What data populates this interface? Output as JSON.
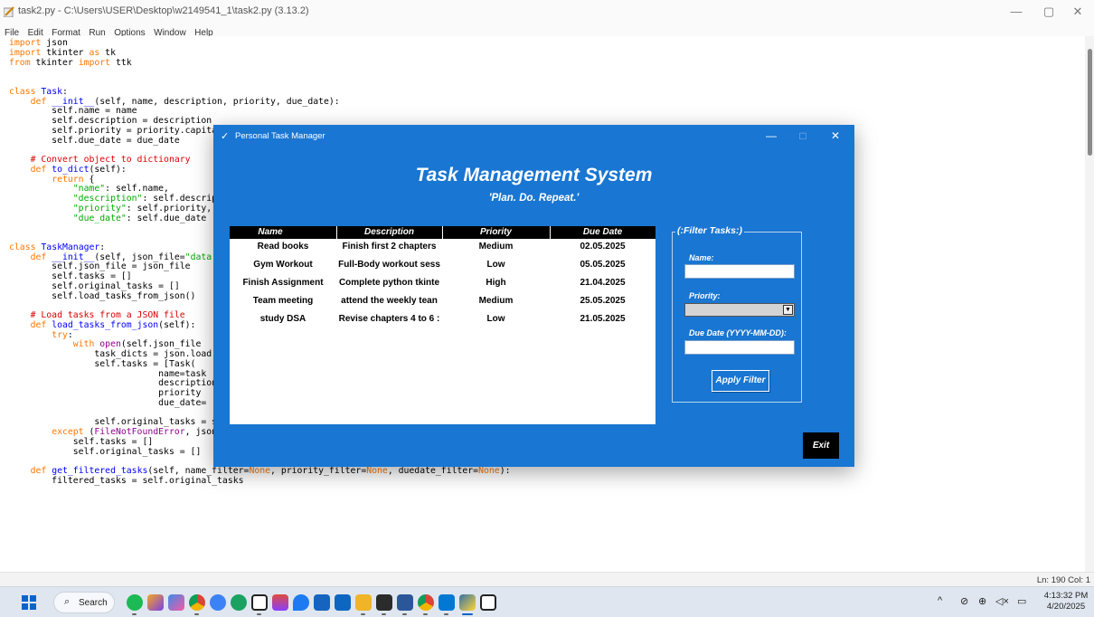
{
  "idle": {
    "window_title": "task2.py - C:\\Users\\USER\\Desktop\\w2149541_1\\task2.py (3.13.2)",
    "menus": [
      "File",
      "Edit",
      "Format",
      "Run",
      "Options",
      "Window",
      "Help"
    ],
    "status_position": "Ln: 190   Col: 1",
    "window_controls": {
      "minimize": "—",
      "restore": "▢",
      "close": "✕"
    }
  },
  "tk_app": {
    "window_title": "Personal Task Manager",
    "heading": "Task Management System",
    "tagline": "'Plan. Do. Repeat.'",
    "controls": {
      "minimize": "—",
      "maximize": "□",
      "close": "✕"
    },
    "table": {
      "columns": [
        "Name",
        "Description",
        "Priority",
        "Due Date"
      ],
      "rows": [
        {
          "name": "Read books",
          "description": "Finish first 2 chapters",
          "priority": "Medium",
          "due": "02.05.2025"
        },
        {
          "name": "Gym Workout",
          "description": "Full-Body workout sess",
          "priority": "Low",
          "due": "05.05.2025"
        },
        {
          "name": "Finish Assignment",
          "description": "Complete python tkintе",
          "priority": "High",
          "due": "21.04.2025"
        },
        {
          "name": "Team meeting",
          "description": "attend the weekly tean",
          "priority": "Medium",
          "due": "25.05.2025"
        },
        {
          "name": "study DSA",
          "description": "Revise chapters 4 to 6 :",
          "priority": "Low",
          "due": "21.05.2025"
        }
      ]
    },
    "filter": {
      "legend": "(:Filter Tasks:)",
      "name_label": "Name:",
      "name_value": "",
      "priority_label": "Priority:",
      "priority_value": "",
      "due_label": "Due Date (YYYY-MM-DD):",
      "due_value": "",
      "apply_label": "Apply Filter"
    },
    "exit_label": "Exit"
  },
  "taskbar": {
    "search_label": "Search",
    "clock_time": "4:13:32 PM",
    "clock_date": "4/20/2025",
    "tray_icons": [
      "chevron-up-icon",
      "wifi-off-icon",
      "network-icon",
      "volume-icon",
      "battery-icon"
    ]
  }
}
